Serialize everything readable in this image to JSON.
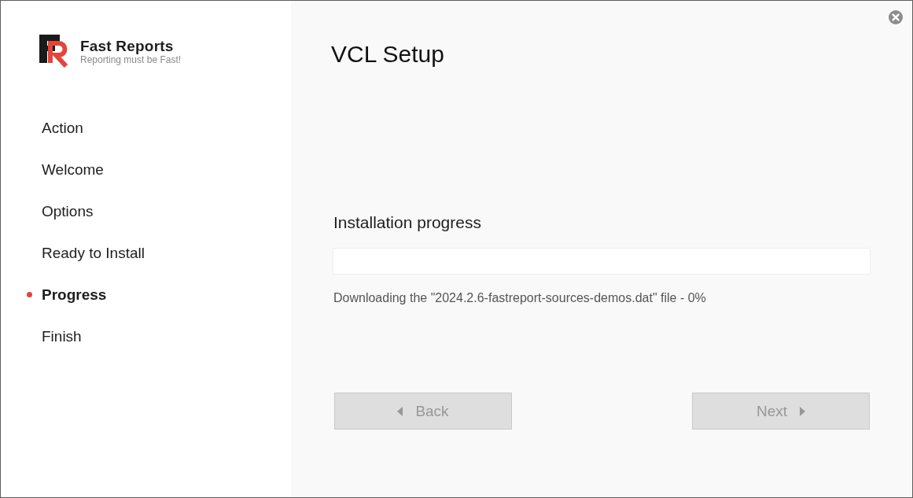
{
  "brand": {
    "name": "Fast Reports",
    "tagline": "Reporting must be Fast!"
  },
  "steps": [
    {
      "label": "Action",
      "selected": false
    },
    {
      "label": "Welcome",
      "selected": false
    },
    {
      "label": "Options",
      "selected": false
    },
    {
      "label": "Ready to Install",
      "selected": false
    },
    {
      "label": "Progress",
      "selected": true
    },
    {
      "label": "Finish",
      "selected": false
    }
  ],
  "title": "VCL Setup",
  "progress": {
    "heading": "Installation progress",
    "level": 0,
    "status": "Downloading the \"2024.2.6-fastreport-sources-demos.dat\" file - 0%"
  },
  "buttons": [
    {
      "label": "Back",
      "kind": "back",
      "disabled": true
    },
    {
      "label": "Next",
      "kind": "next",
      "disabled": true
    }
  ]
}
